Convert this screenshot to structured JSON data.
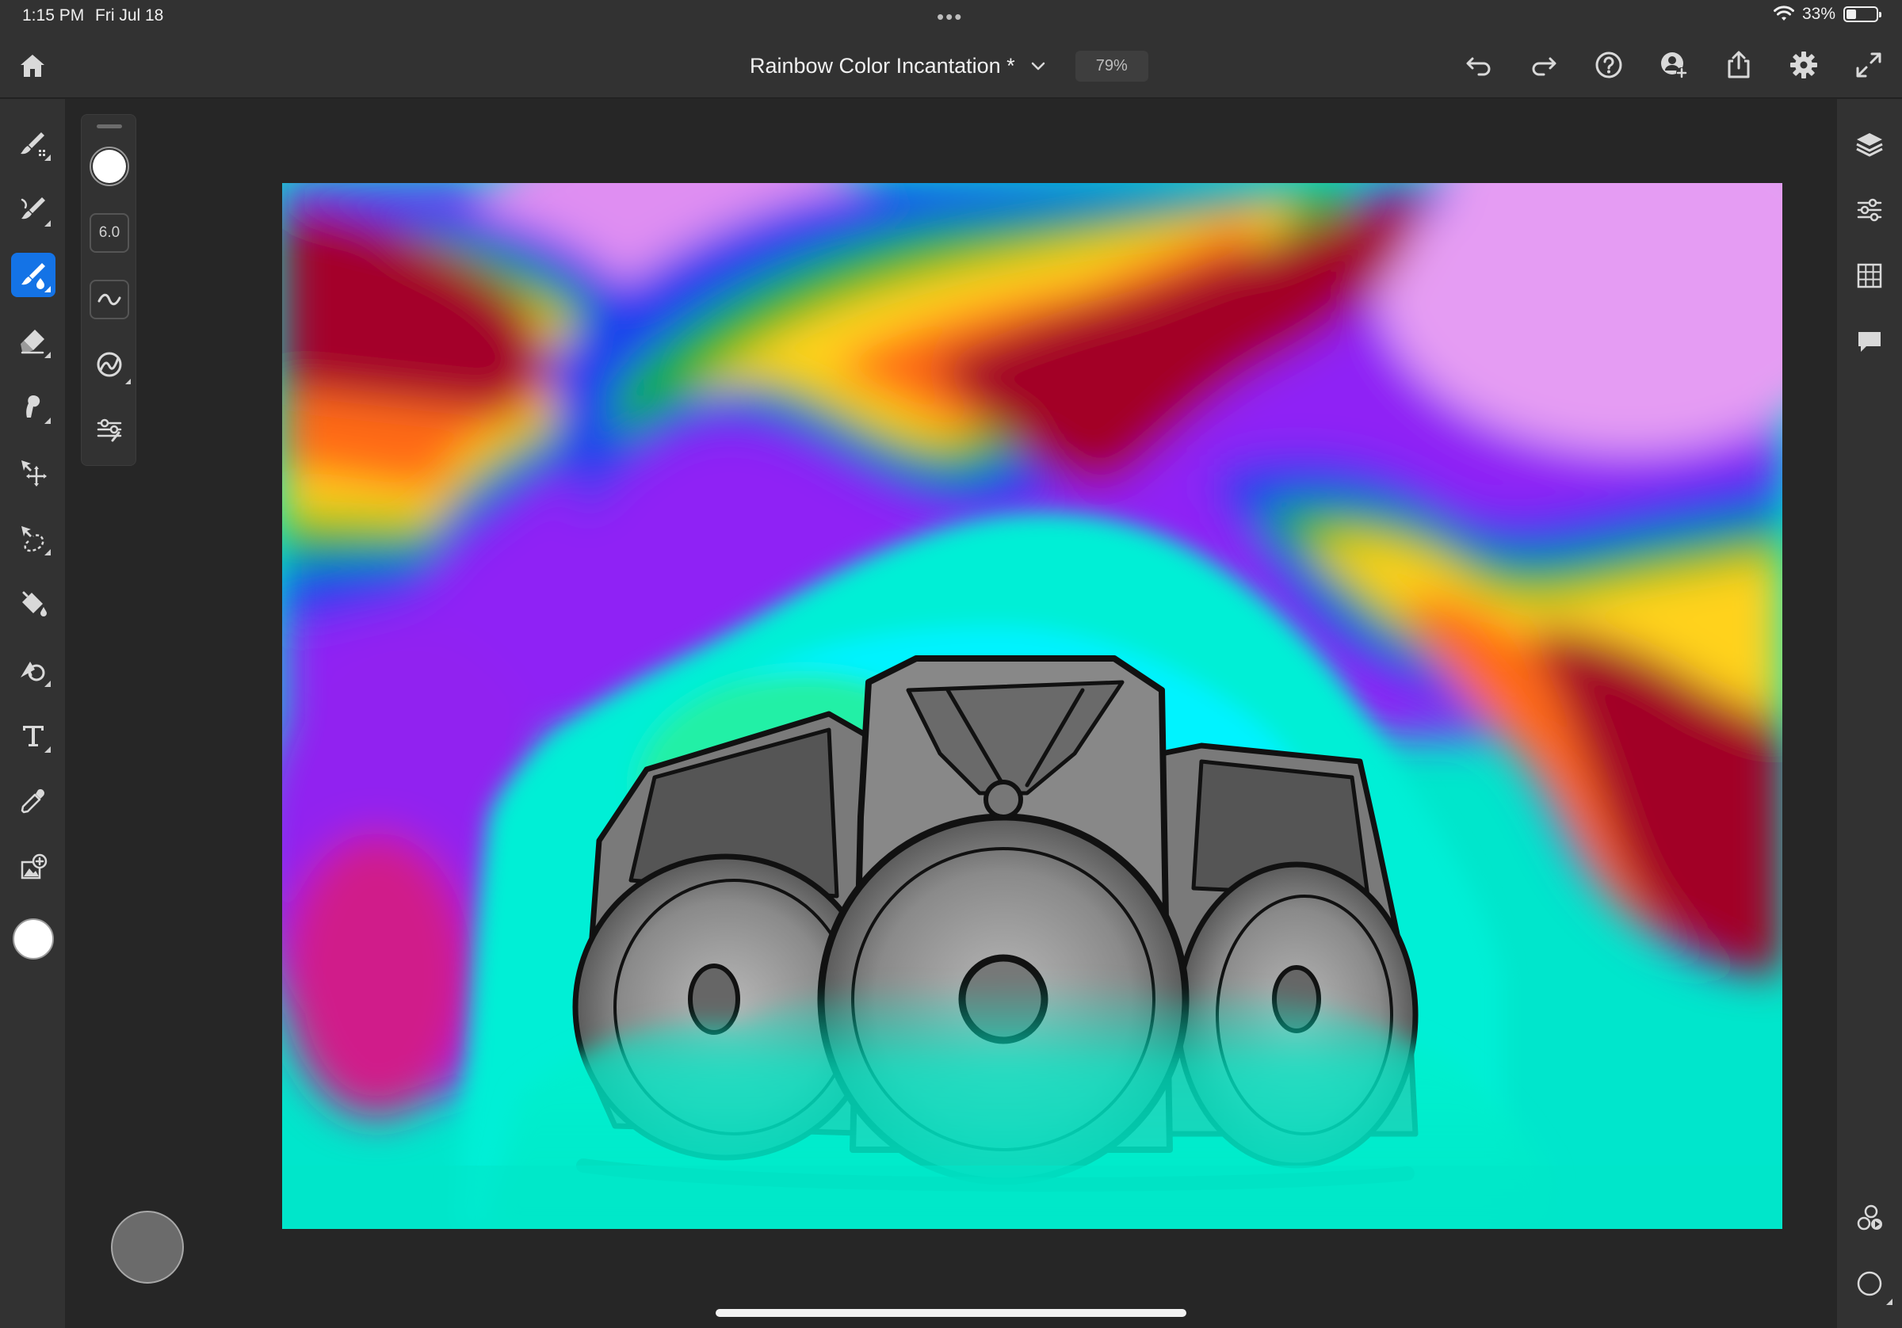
{
  "status_bar": {
    "time": "1:15 PM",
    "date": "Fri Jul 18",
    "more_dots": "•••",
    "battery_percent": 33,
    "battery_label": "33%"
  },
  "toolbar": {
    "title": "Rainbow Color Incantation *",
    "zoom": "79%",
    "icons": [
      "home-icon",
      "chevron-down-icon",
      "undo-icon",
      "redo-icon",
      "help-icon",
      "invite-icon",
      "share-icon",
      "settings-icon",
      "fullscreen-icon"
    ]
  },
  "left_tools": {
    "active_index": 2,
    "items": [
      "paint-brush-icon",
      "pixel-brush-icon",
      "live-brush-icon",
      "eraser-icon",
      "smudge-icon",
      "move-icon",
      "selection-icon",
      "fill-icon",
      "shape-icon",
      "text-icon",
      "eyedropper-icon",
      "place-image-icon"
    ],
    "color": "#ffffff"
  },
  "brush_panel": {
    "size_value": "6.0",
    "brush_color": "#ffffff",
    "icons": [
      "brush-size-icon",
      "flow-icon",
      "smoothing-icon",
      "brush-settings-icon"
    ]
  },
  "right_tools": {
    "items": [
      "layers-icon",
      "layer-properties-icon",
      "grid-icon",
      "comments-icon"
    ],
    "bottom_items": [
      "livestream-icon",
      "touch-shortcut-icon"
    ]
  },
  "colors": {
    "accent": "#1473e6",
    "chrome": "#323232",
    "background": "#262626"
  }
}
